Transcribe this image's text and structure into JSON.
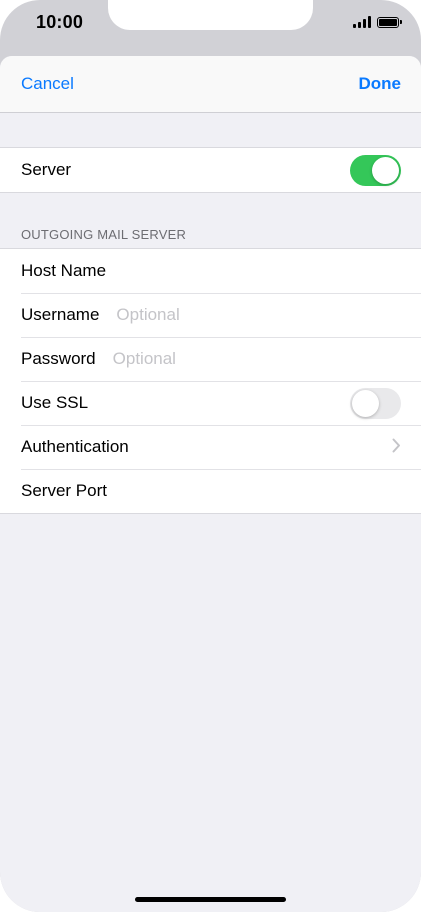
{
  "status_bar": {
    "time": "10:00",
    "icons": [
      "cellular-signal-icon",
      "battery-icon"
    ]
  },
  "nav": {
    "cancel_label": "Cancel",
    "done_label": "Done"
  },
  "server_group": {
    "server_label": "Server",
    "server_toggle_on": true
  },
  "outgoing": {
    "section_title": "OUTGOING MAIL SERVER",
    "host_name_label": "Host Name",
    "username_label": "Username",
    "username_placeholder": "Optional",
    "password_label": "Password",
    "password_placeholder": "Optional",
    "use_ssl_label": "Use SSL",
    "use_ssl_on": false,
    "authentication_label": "Authentication",
    "server_port_label": "Server Port"
  },
  "colors": {
    "accent": "#0a7aff",
    "toggle_on": "#34c759",
    "background": "#f0f0f5"
  }
}
